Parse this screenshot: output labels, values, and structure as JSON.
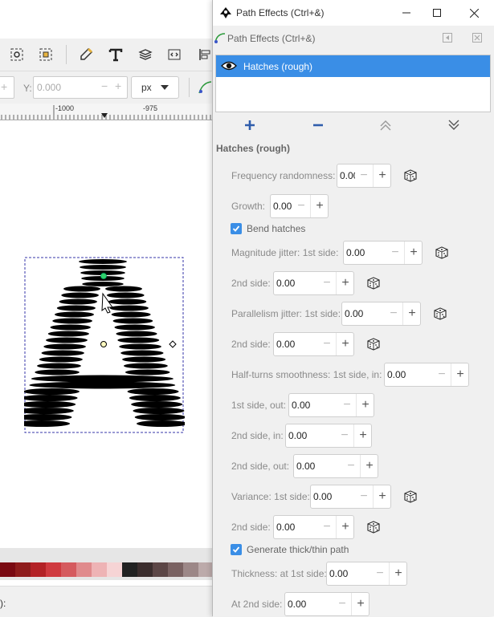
{
  "dialog": {
    "window_title": "Path Effects (Ctrl+&)",
    "panel_title": "Path Effects (Ctrl+&)",
    "effects": [
      {
        "name": "Hatches (rough)",
        "visible": true,
        "selected": true
      }
    ],
    "section_title": "Hatches (rough)",
    "params": {
      "frequency_randomness": {
        "label": "Frequency randomness:",
        "value": "0.00"
      },
      "growth": {
        "label": "Growth:",
        "value": "0.00"
      },
      "bend_hatches": {
        "label": "Bend hatches",
        "checked": true
      },
      "magnitude_jitter_1": {
        "label": "Magnitude jitter: 1st side:",
        "value": "0.00"
      },
      "magnitude_jitter_2": {
        "label": "2nd side:",
        "value": "0.00"
      },
      "parallelism_jitter_1": {
        "label": "Parallelism jitter: 1st side:",
        "value": "0.00"
      },
      "parallelism_jitter_2": {
        "label": "2nd side:",
        "value": "0.00"
      },
      "half_turns_1_in": {
        "label": "Half-turns smoothness: 1st side, in:",
        "value": "0.00"
      },
      "half_turns_1_out": {
        "label": "1st side, out:",
        "value": "0.00"
      },
      "half_turns_2_in": {
        "label": "2nd side, in:",
        "value": "0.00"
      },
      "half_turns_2_out": {
        "label": "2nd side, out:",
        "value": "0.00"
      },
      "variance_1": {
        "label": "Variance: 1st side:",
        "value": "0.00"
      },
      "variance_2": {
        "label": "2nd side:",
        "value": "0.00"
      },
      "generate_thick_thin": {
        "label": "Generate thick/thin path",
        "checked": true
      },
      "thickness_1": {
        "label": "Thickness: at 1st side:",
        "value": "0.00"
      },
      "thickness_2": {
        "label": "At 2nd side:",
        "value": "0.00"
      }
    }
  },
  "canvas": {
    "y_label": "Y:",
    "y_value": "0.000",
    "unit": "px",
    "ruler_ticks": [
      "-1000",
      "-975"
    ],
    "status_text": "):"
  },
  "colors": {
    "accent": "#3a8ee6",
    "palette": [
      "#7a0a12",
      "#8e1c1c",
      "#b32226",
      "#cf3a3f",
      "#d55a5e",
      "#e08a8c",
      "#eeb3b5",
      "#f6d4d5",
      "#222222",
      "#3b2d2d",
      "#5c4646",
      "#7a6262",
      "#9c8787",
      "#bcaaaa",
      "#d8cccc"
    ]
  }
}
